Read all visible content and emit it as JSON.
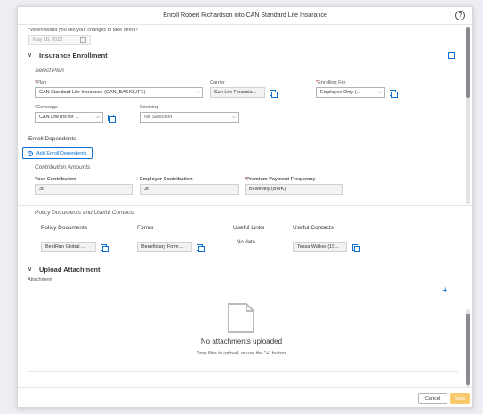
{
  "dialog": {
    "title": "Enroll Robert Richardson into CAN Standard Life Insurance",
    "help_icon": "?"
  },
  "effective": {
    "label": "When would you like your changes to take effect?",
    "value": "May 18, 2020"
  },
  "enrollment": {
    "title": "Insurance Enrollment",
    "select_plan": "Select Plan",
    "plan": {
      "label": "Plan",
      "value": "CAN Standard Life Insurance (CAN_BASICLIFE)"
    },
    "carrier": {
      "label": "Carrier",
      "value": "Sun Life Financia..."
    },
    "enrolling_for": {
      "label": "Enrolling For",
      "value": "Employee Only (..."
    },
    "coverage": {
      "label": "Coverage",
      "value": "CAN Life Ins for ..."
    },
    "smoking": {
      "label": "Smoking",
      "value": "No Selection"
    },
    "enroll_dependents": "Enroll Dependents",
    "add_dependents": "Add Enroll Dependents",
    "contribution_title": "Contribution Amounts",
    "your_contribution": {
      "label": "Your Contribution",
      "value": "36"
    },
    "employer_contribution": {
      "label": "Employer Contribution",
      "value": "36"
    },
    "frequency": {
      "label": "Premium Payment Frequency",
      "value": "Bi-weekly (BWK)"
    }
  },
  "policy": {
    "title": "Policy Documents and Useful Contacts",
    "columns": [
      "Policy Documents",
      "Forms",
      "Useful Links",
      "Useful Contacts"
    ],
    "policy_doc": "BestRun Global ...",
    "form": "Beneficiary Form ...",
    "links": "No data",
    "contact": "Tessa Walker (15..."
  },
  "upload": {
    "title": "Upload Attachment",
    "attachment_label": "Attachment",
    "add": "+",
    "empty_title": "No attachments uploaded",
    "empty_hint": "Drop files to upload, or use the \"+\" button."
  },
  "footer": {
    "cancel": "Cancel",
    "save": "Save"
  },
  "colors": {
    "accent": "#0a6ed1",
    "save": "#f7c96b",
    "required": "#cc0000"
  }
}
